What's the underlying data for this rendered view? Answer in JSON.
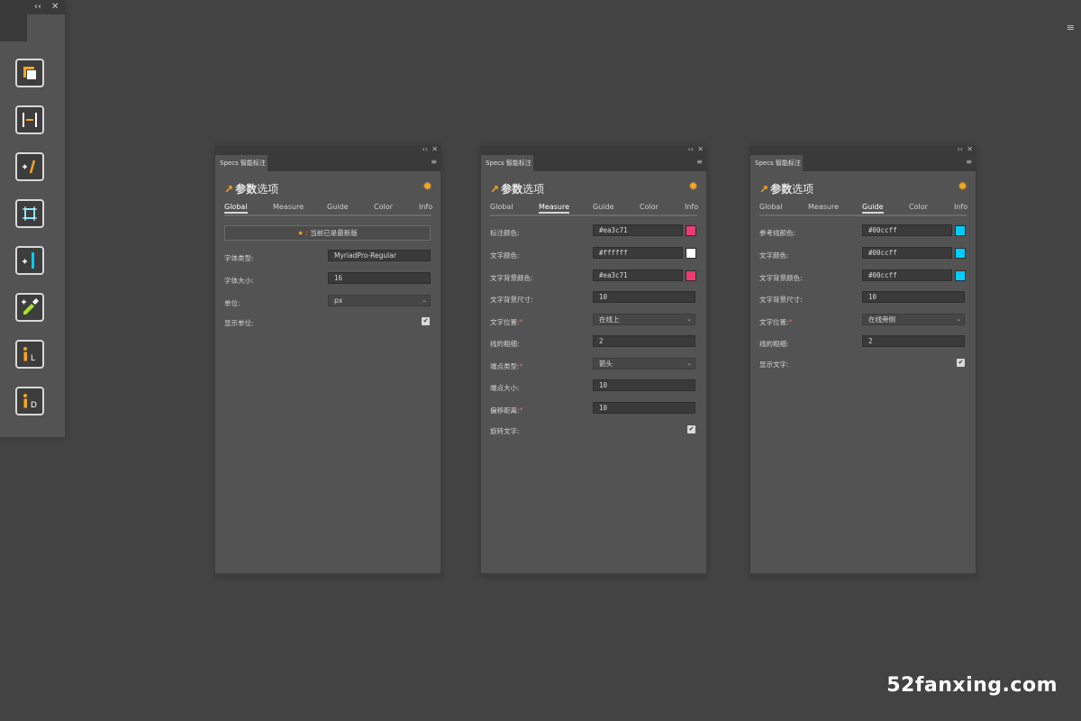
{
  "toolbar": {
    "collapse": "‹‹",
    "close": "✕",
    "menu": "≡",
    "tools": [
      "artboard-tool",
      "spacing-tool",
      "text-spec-tool",
      "bounds-tool",
      "measure-tool",
      "color-picker-tool",
      "info-l-tool",
      "info-d-tool"
    ]
  },
  "panel_common": {
    "tab": "Specs 智能标注",
    "title_bold": "参数",
    "title_rest": "选项",
    "collapse": "‹‹",
    "close": "✕",
    "menu": "≡",
    "subtabs": [
      "Global",
      "Measure",
      "Guide",
      "Color",
      "Info"
    ]
  },
  "global_panel": {
    "notice": "当前已是最新版",
    "notice_prefix": "★ :",
    "fields": [
      {
        "label": "字体类型:",
        "value": "MyriadPro-Regular"
      },
      {
        "label": "字体大小:",
        "value": "16"
      },
      {
        "label": "单位:",
        "value": "px"
      },
      {
        "label": "显示单位:",
        "value": "✔"
      }
    ]
  },
  "measure_panel": {
    "fields": [
      {
        "label": "标注颜色:",
        "value": "#ea3c71",
        "swatch": "#ea3c71"
      },
      {
        "label": "文字颜色:",
        "value": "#ffffff",
        "swatch": "#ffffff"
      },
      {
        "label": "文字背景颜色:",
        "value": "#ea3c71",
        "swatch": "#ea3c71"
      },
      {
        "label": "文字背景尺寸:",
        "value": "10"
      },
      {
        "label": "文字位置:",
        "value": "在线上",
        "required": "*"
      },
      {
        "label": "线的粗细:",
        "value": "2"
      },
      {
        "label": "端点类型:",
        "value": "箭头",
        "required": "*"
      },
      {
        "label": "端点大小:",
        "value": "10"
      },
      {
        "label": "偏移距离:",
        "value": "10",
        "required": "*"
      },
      {
        "label": "旋转文字:",
        "value": "✔"
      }
    ]
  },
  "guide_panel": {
    "fields": [
      {
        "label": "参考线颜色:",
        "value": "#00ccff",
        "swatch": "#00ccff"
      },
      {
        "label": "文字颜色:",
        "value": "#00ccff",
        "swatch": "#00ccff"
      },
      {
        "label": "文字背景颜色:",
        "value": "#00ccff",
        "swatch": "#00ccff"
      },
      {
        "label": "文字背景尺寸:",
        "value": "10"
      },
      {
        "label": "文字位置:",
        "value": "在线旁侧",
        "required": "*"
      },
      {
        "label": "线的粗细:",
        "value": "2"
      },
      {
        "label": "显示文字:",
        "value": "✔"
      }
    ]
  },
  "watermark": "52fanxing.com",
  "colors": {
    "accent": "#f5a623",
    "pink": "#ea3c71",
    "cyan": "#00ccff"
  }
}
